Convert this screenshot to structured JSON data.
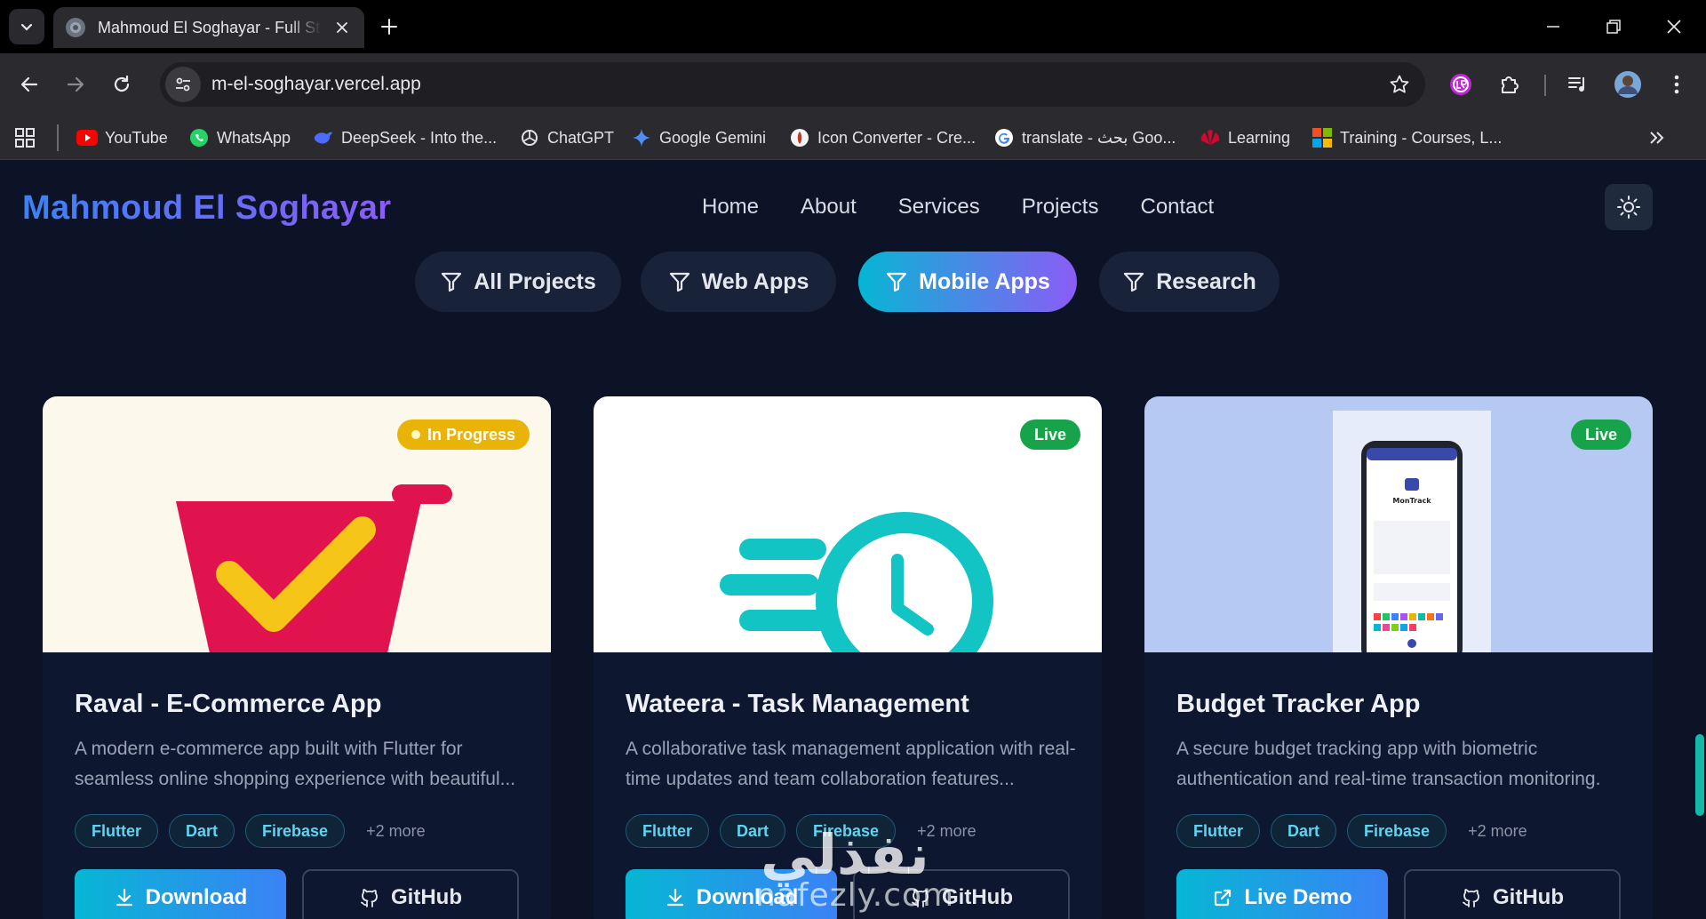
{
  "browser": {
    "tab_title": "Mahmoud El Soghayar - Full Stack",
    "url": "m-el-soghayar.vercel.app",
    "bookmarks": [
      {
        "label": "YouTube",
        "icon": "youtube-icon",
        "color": "#ff0000"
      },
      {
        "label": "WhatsApp",
        "icon": "whatsapp-icon",
        "color": "#25d366"
      },
      {
        "label": "DeepSeek - Into the...",
        "icon": "deepseek-icon",
        "color": "#4d6bfe"
      },
      {
        "label": "ChatGPT",
        "icon": "chatgpt-icon",
        "color": "#e3e3e6"
      },
      {
        "label": "Google Gemini",
        "icon": "gemini-icon",
        "color": "#4f8df5"
      },
      {
        "label": "Icon Converter - Cre...",
        "icon": "icon-converter-icon",
        "color": "#c0392b"
      },
      {
        "label": "translate - بحث Goo...",
        "icon": "google-icon",
        "color": "#4285f4"
      },
      {
        "label": "Learning",
        "icon": "huawei-icon",
        "color": "#cf0a2c"
      },
      {
        "label": "Training - Courses, L...",
        "icon": "microsoft-icon",
        "color": "#f25022"
      }
    ]
  },
  "site": {
    "brand": "Mahmoud El Soghayar",
    "nav": [
      "Home",
      "About",
      "Services",
      "Projects",
      "Contact"
    ],
    "filters": [
      "All Projects",
      "Web Apps",
      "Mobile Apps",
      "Research"
    ],
    "active_filter": "Mobile Apps",
    "colors": {
      "accent_cyan": "#06b6d4",
      "accent_purple": "#8b5cf6",
      "background": "#0c1326"
    }
  },
  "projects": [
    {
      "title": "Raval - E-Commerce App",
      "description": "A modern e-commerce app built with Flutter for seamless online shopping experience with beautiful...",
      "status": "In Progress",
      "tags": [
        "Flutter",
        "Dart",
        "Firebase"
      ],
      "more": "+2 more",
      "primary": "Download",
      "secondary": "GitHub"
    },
    {
      "title": "Wateera - Task Management",
      "description": "A collaborative task management application with real-time updates and team collaboration features...",
      "status": "Live",
      "tags": [
        "Flutter",
        "Dart",
        "Firebase"
      ],
      "more": "+2 more",
      "primary": "Download",
      "secondary": "GitHub"
    },
    {
      "title": "Budget Tracker App",
      "description": "A secure budget tracking app with biometric authentication and real-time transaction monitoring.",
      "status": "Live",
      "tags": [
        "Flutter",
        "Dart",
        "Firebase"
      ],
      "more": "+2 more",
      "primary": "Live Demo",
      "secondary": "GitHub",
      "phone_app_name": "MonTrack"
    }
  ],
  "watermark": {
    "arabic": "نفذلي",
    "latin": "nafezly.com"
  }
}
